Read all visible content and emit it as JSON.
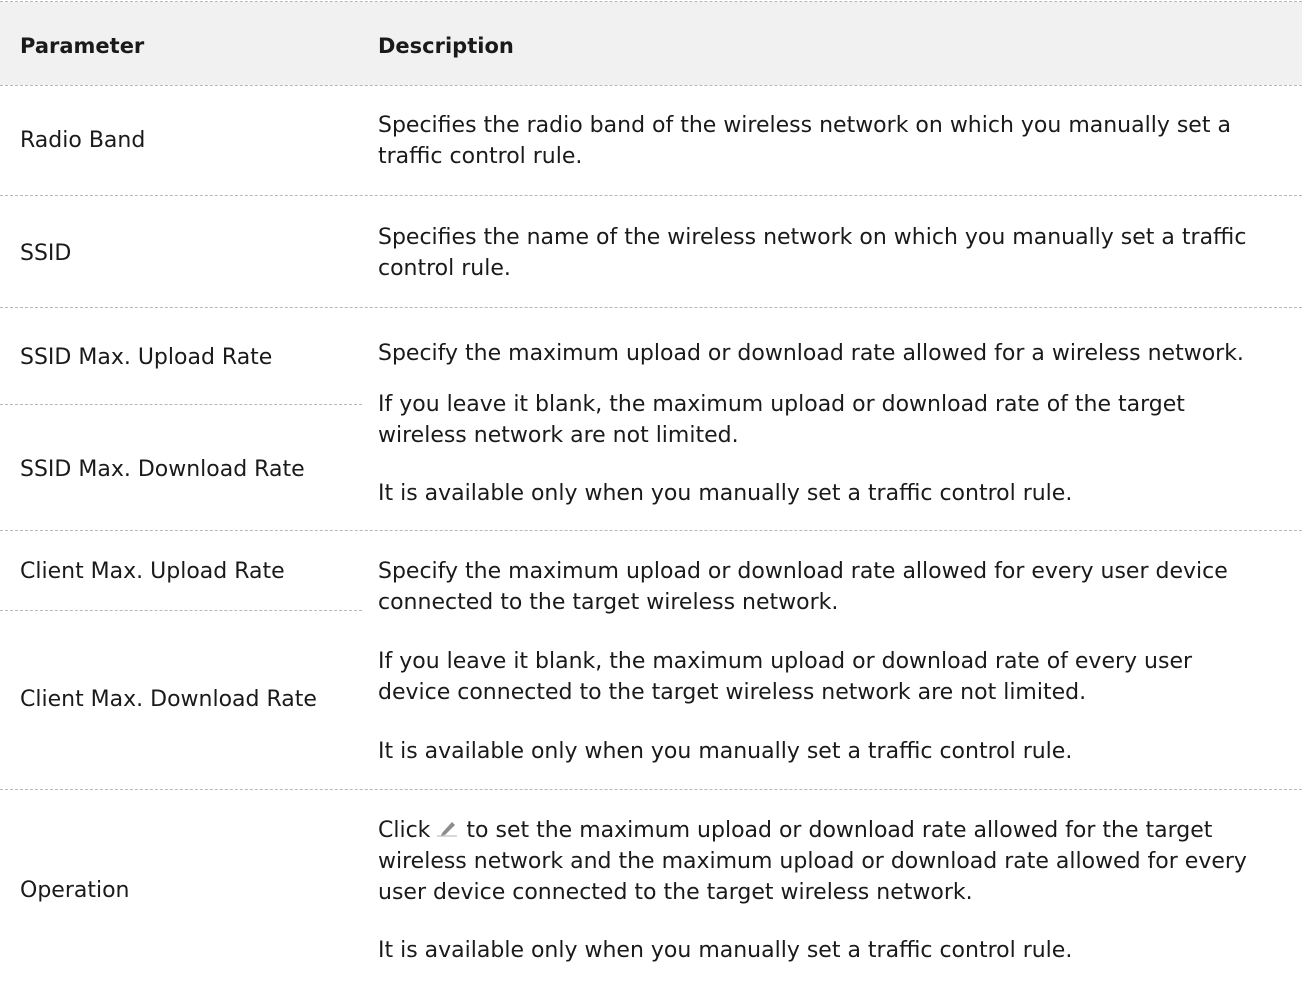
{
  "header": {
    "parameter": "Parameter",
    "description": "Description"
  },
  "rows": {
    "radio_band": {
      "param": "Radio Band",
      "desc1": "Specifies the radio band of the wireless network on which you manually set a",
      "desc2": "traffic control rule."
    },
    "ssid": {
      "param": "SSID",
      "desc1": "Specifies the name of the wireless network on which you manually set a traffic",
      "desc2": "control rule."
    },
    "ssid_rate": {
      "param_upload": "SSID Max. Upload Rate",
      "param_download": "SSID Max. Download Rate",
      "p1": "Specify the maximum upload or download rate allowed for a wireless network.",
      "p2a": "If you leave it blank, the maximum upload or download rate of the target",
      "p2b": "wireless network are not limited.",
      "p3": "It is available only when you manually set a traffic control rule."
    },
    "client_rate": {
      "param_upload": "Client Max. Upload Rate",
      "param_download": "Client Max. Download Rate",
      "p1a": "Specify the maximum upload or download rate allowed for every user device",
      "p1b": "connected to the target wireless network.",
      "p2a": "If you leave it blank, the maximum upload or download rate of every user",
      "p2b": "device connected to the target wireless network are not limited.",
      "p3": "It is available only when you manually set a traffic control rule."
    },
    "operation": {
      "param": "Operation",
      "click": "Click",
      "icon": "edit-pencil-icon",
      "l1": "to set the maximum upload or download rate allowed for the target",
      "l2": "wireless network and the maximum upload or download rate allowed for every",
      "l3": "user device connected to the target wireless network.",
      "p2": "It is available only when you manually set a traffic control rule."
    }
  },
  "colors": {
    "header_bg": "#f1f1f1",
    "divider": "#b8b8b8",
    "text": "#1a1a1a",
    "icon": "#8c8c8c"
  }
}
